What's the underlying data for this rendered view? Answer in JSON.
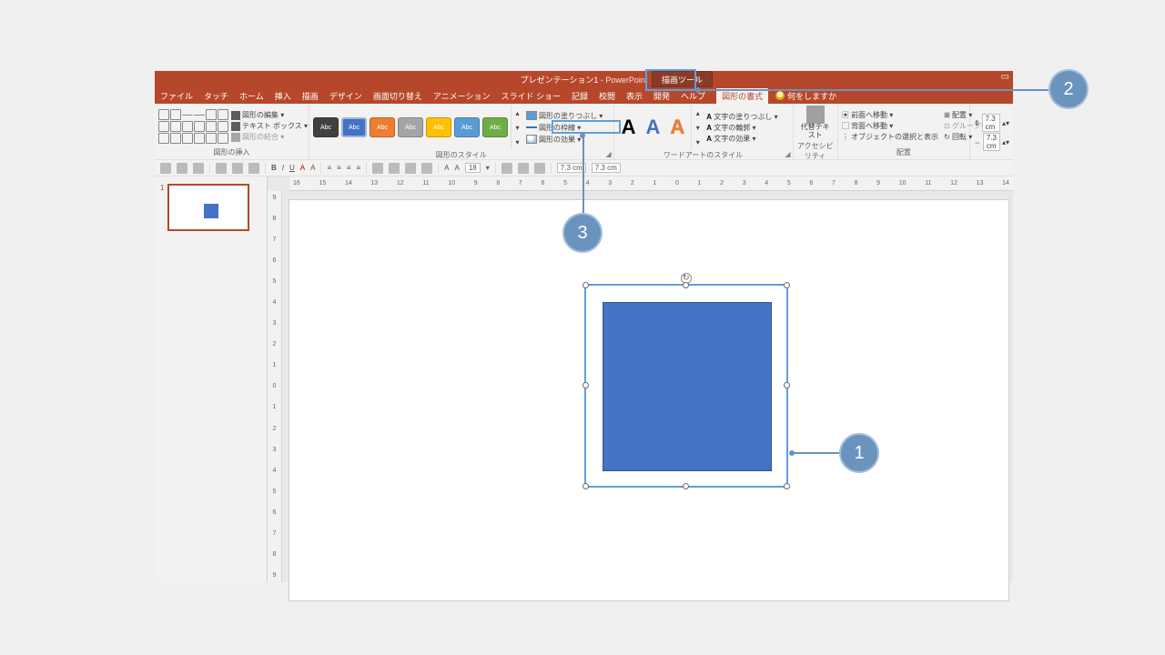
{
  "title": {
    "document": "プレゼンテーション1",
    "separator": " - ",
    "app": "PowerPoint"
  },
  "contextual_tab": "描画ツール",
  "tabs": [
    "ファイル",
    "タッチ",
    "ホーム",
    "挿入",
    "描画",
    "デザイン",
    "画面切り替え",
    "アニメーション",
    "スライド ショー",
    "記録",
    "校閲",
    "表示",
    "開発",
    "ヘルプ",
    "図形の書式"
  ],
  "active_tab_index": 14,
  "tell_me": "何をしますか",
  "ribbon": {
    "group_insert": {
      "title": "図形の挿入",
      "edit_shape": "図形の編集 ▾",
      "text_box": "テキスト ボックス ▾",
      "merge": "図形の結合 ▾"
    },
    "group_styles": {
      "title": "図形のスタイル",
      "chip_label": "Abc",
      "fill": "図形の塗りつぶし ▾",
      "outline": "図形の枠線 ▾",
      "effects": "図形の効果 ▾"
    },
    "group_wordart": {
      "title": "ワードアートのスタイル",
      "text_fill": "文字の塗りつぶし ▾",
      "text_outline": "文字の輪郭 ▾",
      "text_effects": "文字の効果 ▾"
    },
    "group_access": {
      "title": "アクセシビリティ",
      "alt_text": "代替テキスト"
    },
    "group_arrange": {
      "title": "配置",
      "bring_fwd": "前面へ移動 ▾",
      "send_back": "背面へ移動 ▾",
      "selection_pane": "オブジェクトの選択と表示",
      "align": "配置 ▾",
      "group": "グループ化 ▾",
      "rotate": "回転 ▾"
    },
    "group_size": {
      "height": "7.3 cm",
      "width": "7.3 cm"
    }
  },
  "toolbar2": {
    "font_size": "18"
  },
  "ruler_h": [
    "16",
    "15",
    "14",
    "13",
    "12",
    "11",
    "10",
    "9",
    "8",
    "7",
    "6",
    "5",
    "4",
    "3",
    "2",
    "1",
    "0",
    "1",
    "2",
    "3",
    "4",
    "5",
    "6",
    "7",
    "8",
    "9",
    "10",
    "11",
    "12",
    "13",
    "14"
  ],
  "ruler_v": [
    "9",
    "8",
    "7",
    "6",
    "5",
    "4",
    "3",
    "2",
    "1",
    "0",
    "1",
    "2",
    "3",
    "4",
    "5",
    "6",
    "7",
    "8",
    "9"
  ],
  "thumbs": {
    "slide1_num": "1"
  },
  "callouts": {
    "c1": "1",
    "c2": "2",
    "c3": "3"
  }
}
